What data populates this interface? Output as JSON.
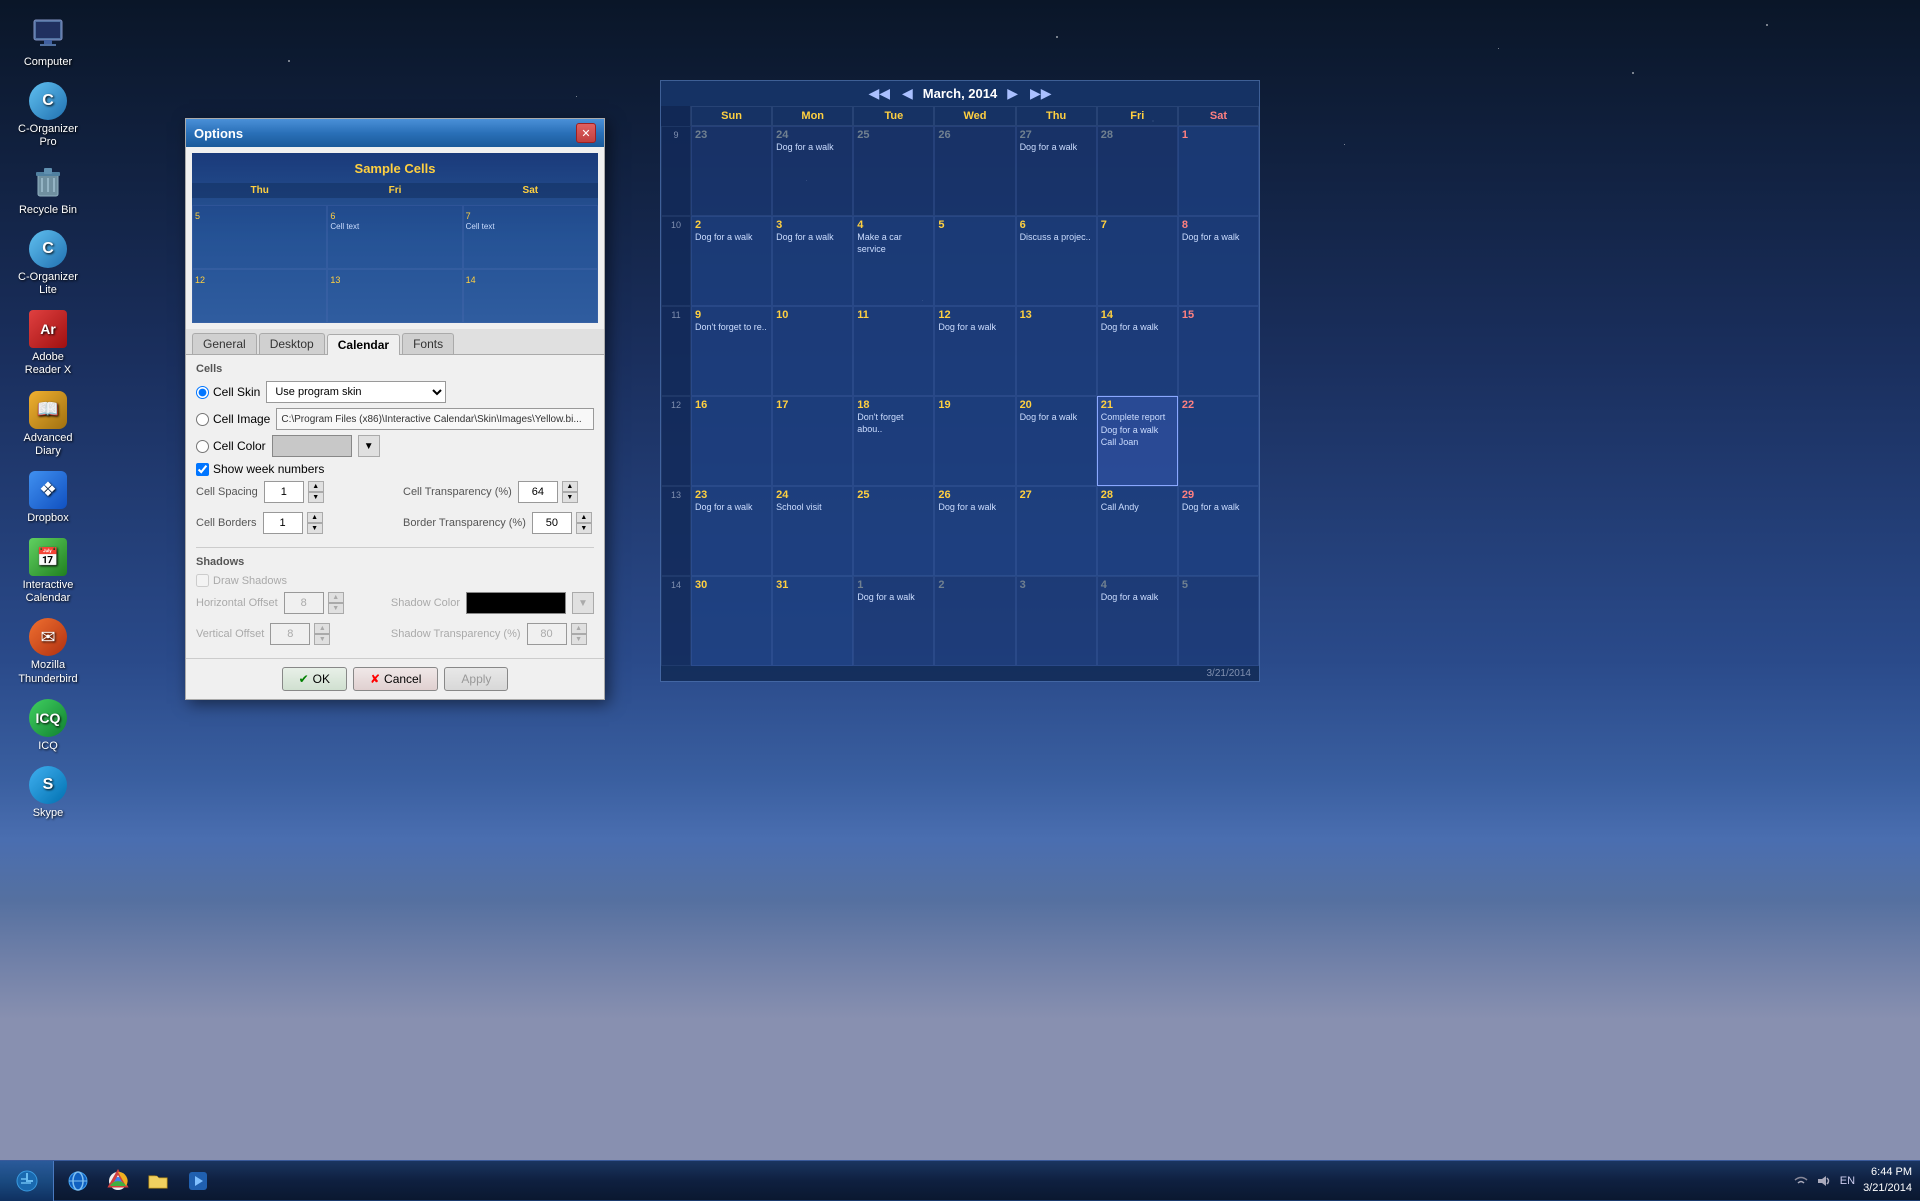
{
  "desktop": {
    "icons": [
      {
        "id": "computer",
        "label": "Computer",
        "color": "#6080c0"
      },
      {
        "id": "corganizer-pro",
        "label": "C-Organizer Pro",
        "color": "#40a0e0"
      },
      {
        "id": "recycle",
        "label": "Recycle Bin",
        "color": "#60c080"
      },
      {
        "id": "corganizer-lite",
        "label": "C-Organizer Lite",
        "color": "#40a0e0"
      },
      {
        "id": "adobe",
        "label": "Adobe Reader X",
        "color": "#d03030"
      },
      {
        "id": "diary",
        "label": "Advanced Diary",
        "color": "#e0a030"
      },
      {
        "id": "dropbox",
        "label": "Dropbox",
        "color": "#3080e0"
      },
      {
        "id": "ical",
        "label": "Interactive Calendar",
        "color": "#50c050"
      },
      {
        "id": "mozilla",
        "label": "Mozilla Thunderbird",
        "color": "#e06030"
      },
      {
        "id": "icq",
        "label": "ICQ",
        "color": "#30c050"
      },
      {
        "id": "skype",
        "label": "Skype",
        "color": "#30a0e0"
      }
    ]
  },
  "calendar": {
    "title": "March, 2014",
    "nav": {
      "prev_year": "◀◀",
      "prev_month": "◀",
      "next_month": "▶",
      "next_year": "▶▶"
    },
    "day_headers": [
      "Sun",
      "Mon",
      "Tue",
      "Wed",
      "Thu",
      "Fri",
      "Sat"
    ],
    "weeks": [
      {
        "num": "9",
        "days": [
          {
            "date": "23",
            "month": "other",
            "events": []
          },
          {
            "date": "24",
            "month": "other",
            "events": [
              "Dog for a walk"
            ]
          },
          {
            "date": "25",
            "month": "other",
            "events": []
          },
          {
            "date": "26",
            "month": "other",
            "events": []
          },
          {
            "date": "27",
            "month": "other",
            "events": [
              "Dog for a walk"
            ]
          },
          {
            "date": "28",
            "month": "other",
            "events": []
          },
          {
            "date": "1",
            "month": "current",
            "events": []
          }
        ]
      },
      {
        "num": "10",
        "days": [
          {
            "date": "2",
            "month": "current",
            "events": [
              "Dog for a walk"
            ]
          },
          {
            "date": "3",
            "month": "current",
            "events": [
              "Dog for a walk"
            ]
          },
          {
            "date": "4",
            "month": "current",
            "events": [
              "Make a car service"
            ]
          },
          {
            "date": "5",
            "month": "current",
            "events": []
          },
          {
            "date": "6",
            "month": "current",
            "events": [
              "Discuss a projec.."
            ]
          },
          {
            "date": "7",
            "month": "current",
            "events": []
          },
          {
            "date": "8",
            "month": "current",
            "events": [
              "Dog for a walk"
            ]
          }
        ]
      },
      {
        "num": "11",
        "days": [
          {
            "date": "9",
            "month": "current",
            "events": [
              "Don't forget to re.."
            ]
          },
          {
            "date": "10",
            "month": "current",
            "events": []
          },
          {
            "date": "11",
            "month": "current",
            "events": []
          },
          {
            "date": "12",
            "month": "current",
            "events": [
              "Dog for a walk"
            ]
          },
          {
            "date": "13",
            "month": "current",
            "events": []
          },
          {
            "date": "14",
            "month": "current",
            "events": [
              "Dog for a walk"
            ]
          },
          {
            "date": "15",
            "month": "current",
            "events": []
          }
        ]
      },
      {
        "num": "12",
        "days": [
          {
            "date": "16",
            "month": "current",
            "events": []
          },
          {
            "date": "17",
            "month": "current",
            "events": []
          },
          {
            "date": "18",
            "month": "current",
            "events": [
              "Don't forget abou.."
            ]
          },
          {
            "date": "19",
            "month": "current",
            "events": []
          },
          {
            "date": "20",
            "month": "current",
            "events": [
              "Dog for a walk"
            ]
          },
          {
            "date": "21",
            "month": "current",
            "selected": true,
            "events": [
              "Complete report",
              "Dog for a walk",
              "Call Joan"
            ]
          },
          {
            "date": "22",
            "month": "current",
            "events": []
          }
        ]
      },
      {
        "num": "13",
        "days": [
          {
            "date": "23",
            "month": "current",
            "events": [
              "Dog for a walk"
            ]
          },
          {
            "date": "24",
            "month": "current",
            "events": [
              "School visit"
            ]
          },
          {
            "date": "25",
            "month": "current",
            "events": []
          },
          {
            "date": "26",
            "month": "current",
            "events": [
              "Dog for a walk"
            ]
          },
          {
            "date": "27",
            "month": "current",
            "events": []
          },
          {
            "date": "28",
            "month": "current",
            "events": [
              "Call Andy"
            ]
          },
          {
            "date": "29",
            "month": "current",
            "events": [
              "Dog for a walk"
            ]
          }
        ]
      },
      {
        "num": "14",
        "days": [
          {
            "date": "30",
            "month": "current",
            "events": []
          },
          {
            "date": "31",
            "month": "current",
            "events": []
          },
          {
            "date": "1",
            "month": "other",
            "events": [
              "Dog for a walk"
            ]
          },
          {
            "date": "2",
            "month": "other",
            "events": []
          },
          {
            "date": "3",
            "month": "other",
            "events": []
          },
          {
            "date": "4",
            "month": "other",
            "events": [
              "Dog for a walk"
            ]
          },
          {
            "date": "5",
            "month": "other",
            "events": []
          }
        ]
      }
    ],
    "statusbar_left": "",
    "statusbar_right": "3/21/2014"
  },
  "options_dialog": {
    "title": "Options",
    "preview_label": "Sample Cells",
    "preview_headers": [
      "Thu",
      "Fri",
      "Sat"
    ],
    "preview_cells": [
      {
        "num": "5",
        "text": ""
      },
      {
        "num": "6",
        "text": "Cell text"
      },
      {
        "num": "7",
        "text": "Cell text"
      },
      {
        "num": "12",
        "text": ""
      },
      {
        "num": "13",
        "text": ""
      },
      {
        "num": "14",
        "text": ""
      }
    ],
    "tabs": [
      "General",
      "Desktop",
      "Calendar",
      "Fonts"
    ],
    "active_tab": "Calendar",
    "sections": {
      "cells_label": "Cells",
      "cell_skin_label": "Cell Skin",
      "cell_skin_value": "Use program skin",
      "cell_image_label": "Cell Image",
      "cell_image_path": "C:\\Program Files (x86)\\Interactive Calendar\\Skin\\Images\\Yellow.bi...",
      "cell_color_label": "Cell Color",
      "show_week_numbers_label": "Show week numbers",
      "cell_spacing_label": "Cell Spacing",
      "cell_spacing_value": "1",
      "cell_transparency_label": "Cell Transparency (%)",
      "cell_transparency_value": "64",
      "cell_borders_label": "Cell Borders",
      "cell_borders_value": "1",
      "border_transparency_label": "Border Transparency (%)",
      "border_transparency_value": "50",
      "shadows_label": "Shadows",
      "draw_shadows_label": "Draw Shadows",
      "horizontal_offset_label": "Horizontal Offset",
      "horizontal_offset_value": "8",
      "vertical_offset_label": "Vertical Offset",
      "vertical_offset_value": "8",
      "shadow_color_label": "Shadow Color",
      "shadow_transparency_label": "Shadow Transparency (%)",
      "shadow_transparency_value": "80"
    },
    "buttons": {
      "ok": "OK",
      "cancel": "Cancel",
      "apply": "Apply"
    }
  },
  "taskbar": {
    "time": "6:44 PM",
    "date": "3/21/2014",
    "lang": "EN"
  }
}
